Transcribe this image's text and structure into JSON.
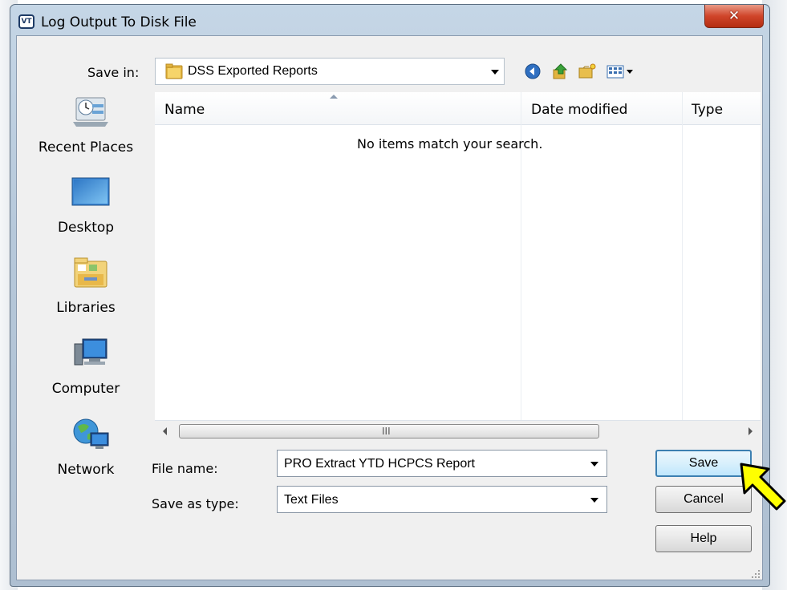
{
  "window": {
    "title": "Log Output To Disk File",
    "app_icon_text": "VT",
    "close_glyph": "✕"
  },
  "save_in": {
    "label": "Save in:",
    "value": "DSS Exported Reports"
  },
  "toolbar": {
    "icons": [
      "back-icon",
      "up-folder-icon",
      "new-folder-icon",
      "view-menu-icon"
    ]
  },
  "places": [
    {
      "label": "Recent Places",
      "icon": "recent-places-icon"
    },
    {
      "label": "Desktop",
      "icon": "desktop-icon"
    },
    {
      "label": "Libraries",
      "icon": "libraries-icon"
    },
    {
      "label": "Computer",
      "icon": "computer-icon"
    },
    {
      "label": "Network",
      "icon": "network-icon"
    }
  ],
  "file_list": {
    "columns": [
      "Name",
      "Date modified",
      "Type"
    ],
    "empty_message": "No items match your search.",
    "scroll_grip": "III"
  },
  "form": {
    "file_name_label": "File name:",
    "file_name_value": "PRO Extract YTD HCPCS Report",
    "save_as_type_label": "Save as type:",
    "save_as_type_value": "Text Files"
  },
  "buttons": {
    "save": "Save",
    "cancel": "Cancel",
    "help": "Help"
  },
  "colors": {
    "pointer_arrow": "#ffff00",
    "close_button": "#c8442a",
    "save_focus_border": "#3c7fb1"
  }
}
